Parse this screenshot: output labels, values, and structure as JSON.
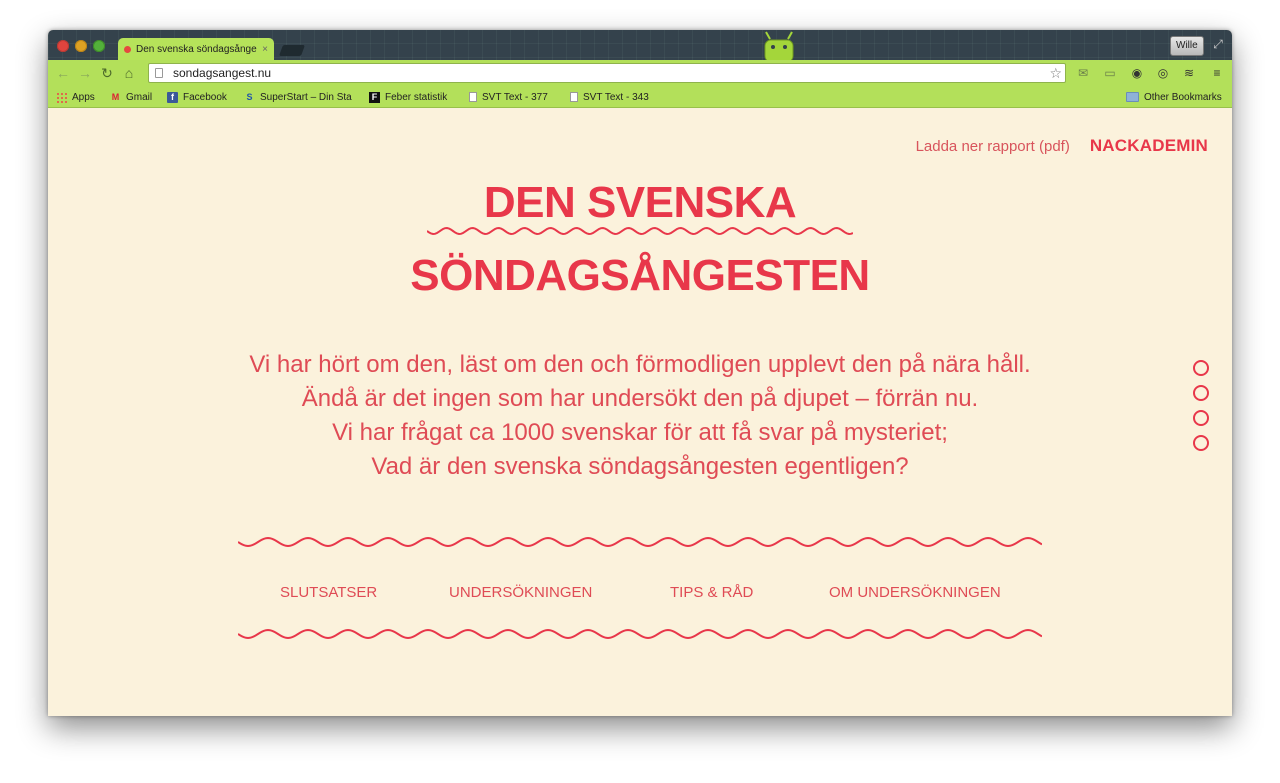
{
  "browser": {
    "tab_title": "Den svenska söndagsånge",
    "tab_close": "×",
    "user_label": "Wille",
    "url": "sondagsangest.nu",
    "bookmarks": [
      {
        "label": "Apps",
        "icon": "apps-icon"
      },
      {
        "label": "Gmail",
        "icon": "gmail-icon"
      },
      {
        "label": "Facebook",
        "icon": "facebook-icon"
      },
      {
        "label": "SuperStart – Din Sta",
        "icon": "superstart-icon"
      },
      {
        "label": "Feber statistik",
        "icon": "feber-icon"
      },
      {
        "label": "SVT Text - 377",
        "icon": "document-icon"
      },
      {
        "label": "SVT Text - 343",
        "icon": "document-icon"
      }
    ],
    "other_bookmarks": "Other Bookmarks"
  },
  "page": {
    "pdf_link": "Ladda ner rapport (pdf)",
    "brand": "NACKADEMIN",
    "title_line1": "DEN SVENSKA",
    "title_line2": "SÖNDAGSÅNGESTEN",
    "intro_lines": [
      "Vi har hört om den, läst om den och förmodligen upplevt den på nära håll.",
      "Ändå är det ingen som har undersökt den på djupet – förrän nu.",
      "Vi har frågat ca 1000 svenskar för att få svar på mysteriet;",
      "Vad är den svenska söndagsångesten egentligen?"
    ],
    "menu": [
      "SLUTSATSER",
      "UNDERSÖKNINGEN",
      "TIPS & RÅD",
      "OM UNDERSÖKNINGEN"
    ],
    "slide_count": 4
  },
  "colors": {
    "accent": "#e8374a",
    "page_background": "#fbf2dc",
    "chrome_green": "#b3e05a"
  }
}
